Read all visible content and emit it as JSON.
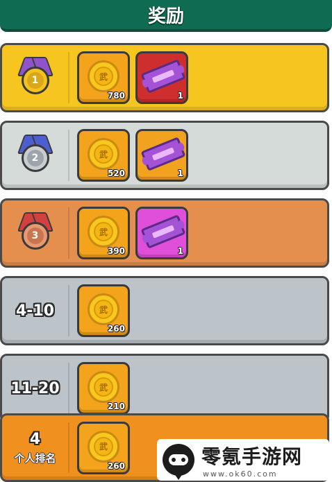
{
  "header": {
    "title": "奖励"
  },
  "rows": [
    {
      "rank": "",
      "medal_label": "1",
      "items": [
        {
          "kind": "coin",
          "count": "780"
        },
        {
          "kind": "ticket",
          "count": "1"
        }
      ]
    },
    {
      "rank": "",
      "medal_label": "2",
      "items": [
        {
          "kind": "coin",
          "count": "520"
        },
        {
          "kind": "ticket",
          "count": "1"
        }
      ]
    },
    {
      "rank": "",
      "medal_label": "3",
      "items": [
        {
          "kind": "coin",
          "count": "390"
        },
        {
          "kind": "ticket",
          "count": "1"
        }
      ]
    },
    {
      "rank": "4-10",
      "items": [
        {
          "kind": "coin",
          "count": "260"
        }
      ]
    },
    {
      "rank": "11-20",
      "items": [
        {
          "kind": "coin",
          "count": "210"
        }
      ]
    },
    {
      "rank": "4",
      "rank_sub": "个人排名",
      "items": [
        {
          "kind": "coin",
          "count": "260"
        }
      ]
    }
  ],
  "coin_glyph": "武",
  "watermark": {
    "name": "零氪手游网",
    "url": "www.ok60.com"
  },
  "colors": {
    "header": "#0f6b52",
    "gold_row": "#f7c51f",
    "silver_row": "#d5dbd8",
    "bronze_row": "#e58f4e",
    "grey_row": "#bcc3c9",
    "player_row": "#f0901e"
  },
  "icons": [
    "gold-medal-icon",
    "silver-medal-icon",
    "bronze-medal-icon",
    "coin-icon",
    "ticket-icon",
    "gamepad-logo-icon"
  ]
}
